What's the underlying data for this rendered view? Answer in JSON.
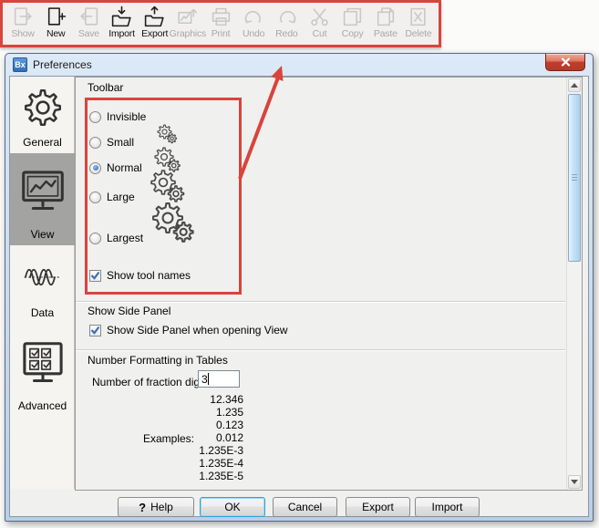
{
  "annotation": {
    "color": "#d8453c"
  },
  "toolbar": {
    "items": [
      {
        "label": "Show",
        "icon": "show-panel-icon",
        "enabled": false
      },
      {
        "label": "New",
        "icon": "new-document-icon",
        "enabled": true
      },
      {
        "label": "Save",
        "icon": "save-icon",
        "enabled": false
      },
      {
        "label": "Import",
        "icon": "import-icon",
        "enabled": true
      },
      {
        "label": "Export",
        "icon": "export-icon",
        "enabled": true
      },
      {
        "label": "Graphics",
        "icon": "graphics-icon",
        "enabled": false
      },
      {
        "label": "Print",
        "icon": "print-icon",
        "enabled": false
      },
      {
        "label": "Undo",
        "icon": "undo-icon",
        "enabled": false
      },
      {
        "label": "Redo",
        "icon": "redo-icon",
        "enabled": false
      },
      {
        "label": "Cut",
        "icon": "cut-icon",
        "enabled": false
      },
      {
        "label": "Copy",
        "icon": "copy-icon",
        "enabled": false
      },
      {
        "label": "Paste",
        "icon": "paste-icon",
        "enabled": false
      },
      {
        "label": "Delete",
        "icon": "delete-icon",
        "enabled": false
      }
    ]
  },
  "dialog": {
    "app_icon_text": "Bx",
    "title": "Preferences"
  },
  "sidebar": {
    "items": [
      {
        "label": "General",
        "icon": "gear-icon",
        "selected": false
      },
      {
        "label": "View",
        "icon": "monitor-chart-icon",
        "selected": true
      },
      {
        "label": "Data",
        "icon": "waves-icon",
        "selected": false
      },
      {
        "label": "Advanced",
        "icon": "monitor-checkboxes-icon",
        "selected": false
      }
    ]
  },
  "content": {
    "toolbar_section": {
      "header": "Toolbar",
      "options": [
        {
          "label": "Invisible",
          "selected": false,
          "gear_preview": null
        },
        {
          "label": "Small",
          "selected": false,
          "gear_preview": "small"
        },
        {
          "label": "Normal",
          "selected": true,
          "gear_preview": "normal"
        },
        {
          "label": "Large",
          "selected": false,
          "gear_preview": "large"
        },
        {
          "label": "Largest",
          "selected": false,
          "gear_preview": "largest"
        }
      ],
      "show_tool_names": {
        "label": "Show tool names",
        "checked": true
      }
    },
    "side_panel_section": {
      "header": "Show Side Panel",
      "checkbox": {
        "label": "Show Side Panel when opening View",
        "checked": true
      }
    },
    "number_section": {
      "header": "Number Formatting in Tables",
      "fraction_digits_label": "Number of fraction digits:",
      "fraction_digits_value": "3",
      "examples_label": "Examples:",
      "examples": [
        "12.346",
        "1.235",
        "0.123",
        "0.012",
        "1.235E-3",
        "1.235E-4",
        "1.235E-5"
      ]
    }
  },
  "footer": {
    "buttons": [
      {
        "prefix": "?",
        "label": "Help"
      },
      {
        "label": "OK",
        "default": true
      },
      {
        "label": "Cancel"
      },
      {
        "label": "Export"
      },
      {
        "label": "Import"
      }
    ]
  }
}
